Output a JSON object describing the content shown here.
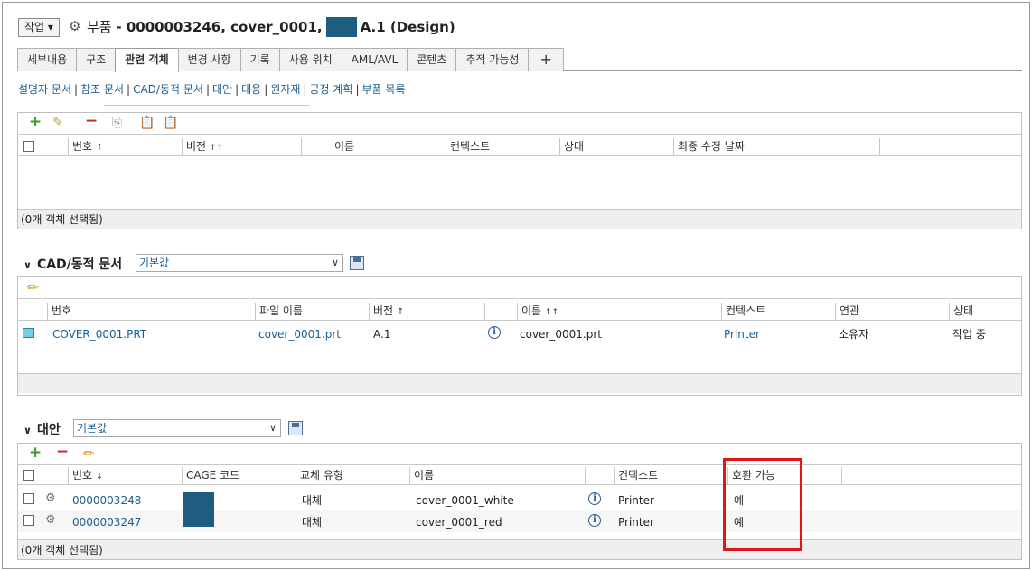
{
  "header": {
    "action_label": "작업 ▾",
    "object_type": "부품",
    "title_prefix": "- 0000003246, cover_0001,",
    "title_suffix": "A.1 (Design)"
  },
  "tabs": [
    "세부내용",
    "구조",
    "관련 객체",
    "변경 사항",
    "기록",
    "사용 위치",
    "AML/AVL",
    "콘텐츠",
    "추적 가능성",
    "+"
  ],
  "active_tab": "관련 객체",
  "sublinks": [
    "설명자 문서",
    "참조 문서",
    "CAD/동적 문서",
    "대안",
    "대용",
    "원자재",
    "공정 계획",
    "부품 목록"
  ],
  "table1": {
    "columns": [
      "번호",
      "버전",
      "이름",
      "컨텍스트",
      "상태",
      "최종 수정 날짜"
    ],
    "sort_up": "↑",
    "sort_multi": "↑↑",
    "footer": "(0개 객체 선택됨)"
  },
  "cad_section": {
    "title": "CAD/동적 문서",
    "view": "기본값",
    "columns": [
      "번호",
      "파일 이름",
      "버전",
      "이름",
      "컨텍스트",
      "연관",
      "상태"
    ],
    "rows": [
      {
        "number": "COVER_0001.PRT",
        "file_name": "cover_0001.prt",
        "version": "A.1",
        "name": "cover_0001.prt",
        "context": "Printer",
        "association": "소유자",
        "state": "작업 중"
      }
    ]
  },
  "alt_section": {
    "title": "대안",
    "view": "기본값",
    "columns": [
      "번호",
      "CAGE 코드",
      "교체 유형",
      "이름",
      "컨텍스트",
      "호환 가능"
    ],
    "rows": [
      {
        "number": "0000003248",
        "type": "대체",
        "name": "cover_0001_white",
        "context": "Printer",
        "compatible": "예"
      },
      {
        "number": "0000003247",
        "type": "대체",
        "name": "cover_0001_red",
        "context": "Printer",
        "compatible": "예"
      }
    ],
    "footer": "(0개 객체 선택됨)"
  },
  "colors": {
    "link": "#1a5e8f",
    "highlight": "#e0141b",
    "redaction": "#1f5d80"
  }
}
